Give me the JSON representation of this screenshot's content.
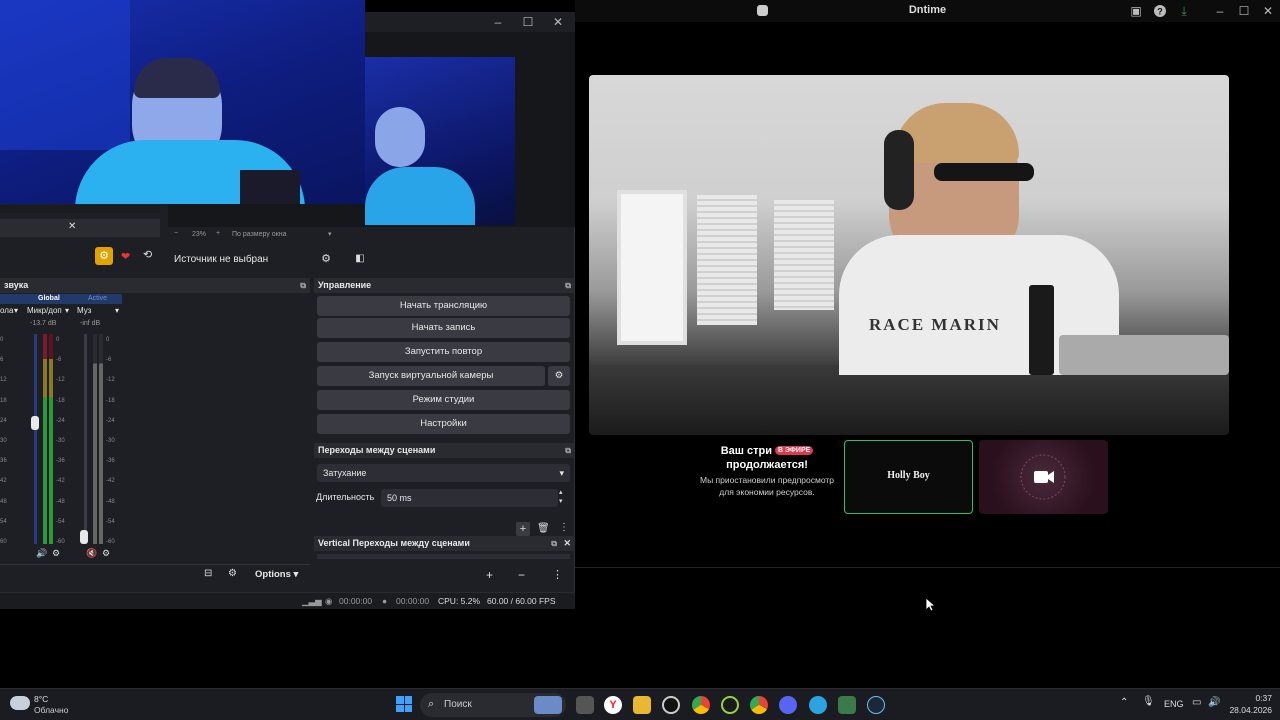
{
  "app": {
    "title": "Dntime",
    "banner": {
      "heading_line1": "Ваш стри",
      "live_badge": "В ЭФИРЕ",
      "heading_line2": "продолжается!",
      "note": "Мы приостановили предпросмотр для экономии ресурсов."
    },
    "thumbs": {
      "holly": "Holly Boy"
    }
  },
  "obs": {
    "zoom": "23%",
    "fit_label": "По размеру окна",
    "source_status": "Источник не выбран",
    "controls": {
      "title": "Управление",
      "start_stream": "Начать трансляцию",
      "start_record": "Начать запись",
      "start_replay": "Запустить повтор",
      "virtual_cam": "Запуск виртуальной камеры",
      "studio_mode": "Режим студии",
      "settings": "Настройки"
    },
    "transitions": {
      "title": "Переходы между сценами",
      "selected": "Затухание",
      "duration_label": "Длительность",
      "duration_value": "50 ms"
    },
    "vertical_transitions": {
      "title": "Vertical Переходы между сценами"
    },
    "mixer": {
      "title": "звука",
      "tab_global": "Global",
      "tab_active": "Active",
      "ch1": "ола",
      "ch2": "Микр/доп",
      "ch3": "Муз",
      "db_mic": "-13.7 dB",
      "db_music": "-inf dB",
      "scale": [
        "0",
        "-6",
        "-12",
        "-18",
        "-24",
        "-30",
        "-36",
        "-42",
        "-48",
        "-54",
        "-60"
      ],
      "options": "Options"
    },
    "status": {
      "rec_time": "00:00:00",
      "stream_time": "00:00:00",
      "cpu": "CPU: 5.2%",
      "fps": "60.00 / 60.00 FPS"
    }
  },
  "taskbar": {
    "weather_temp": "8°C",
    "weather_desc": "Облачно",
    "search": "Поиск",
    "lang": "ENG",
    "time": "0:37",
    "date": "28.04.2026"
  }
}
